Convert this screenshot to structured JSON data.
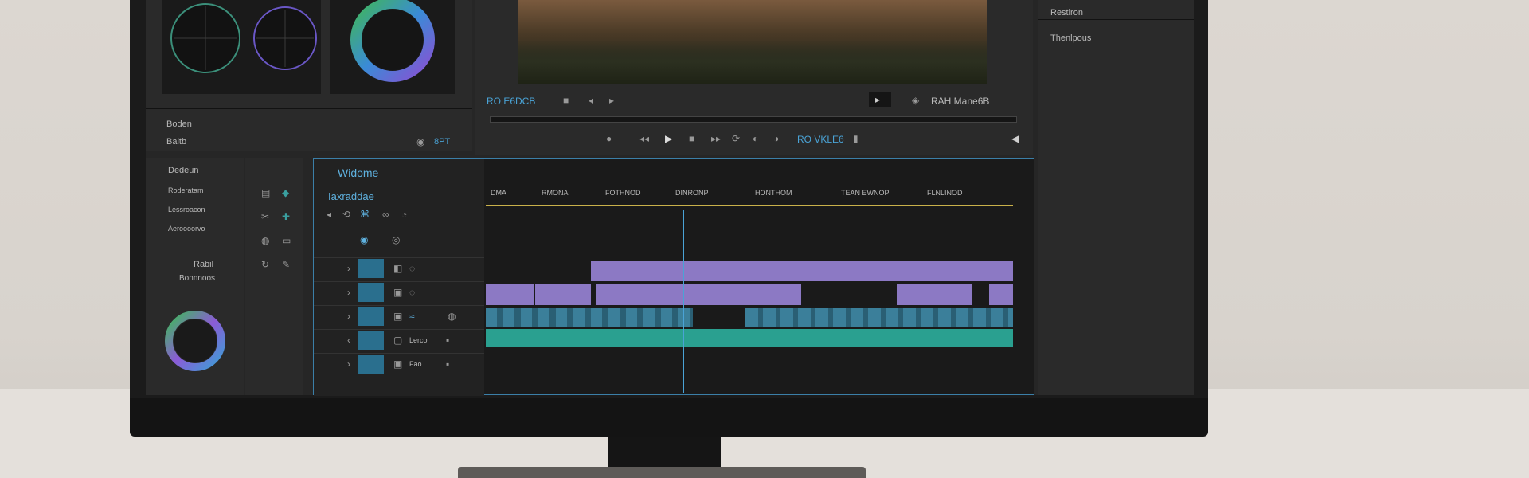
{
  "header_right": {
    "panel_label_1": "Restiron",
    "panel_label_2": "Thenlpous"
  },
  "color_panel": {
    "label_1": "Boden",
    "label_2": "Baitb",
    "value_text": "8PT"
  },
  "viewer": {
    "timecode_left": "RO E6DCB",
    "timecode_right": "RAH Mane6B",
    "timecode_center": "RO VKLE6"
  },
  "left_column": {
    "heading": "Dedeun",
    "items": [
      "Roderatam",
      "Lessroacon",
      "Aeroooorvo"
    ],
    "sublabel_1": "Rabil",
    "sublabel_2": "Bonnnoos"
  },
  "timeline": {
    "title": "Widome",
    "subtitle": "Iaxraddae",
    "ruler_labels": [
      "DMA",
      "RMONA",
      "FOTHNOD",
      "DINRONP",
      "HONTHOM",
      "TEAN EWNOP",
      "FLNLINOD"
    ],
    "track_names": [
      "Lerco",
      "Fao"
    ],
    "colors": {
      "accent": "#4aa3d6",
      "clip_purple": "#8c79c4",
      "clip_teal": "#2aa090",
      "playhead": "#4aa3d6",
      "ruler_line": "#c9b14a"
    }
  }
}
